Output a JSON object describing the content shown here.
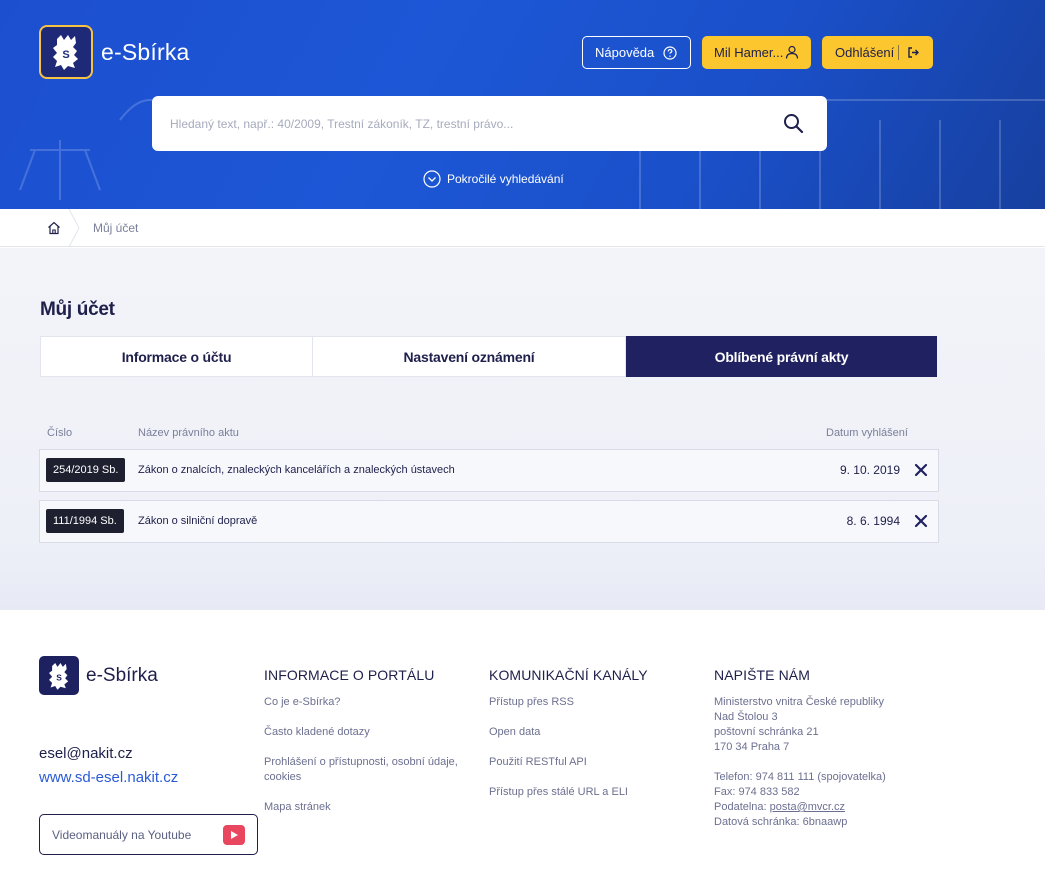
{
  "header": {
    "logo_text": "e-Sbírka",
    "help_label": "Nápověda",
    "user_label": "Mil Hamer...",
    "logout_label": "Odhlášení",
    "search_placeholder": "Hledaný text, např.: 40/2009, Trestní zákoník, TZ, trestní právo...",
    "advanced_search_label": "Pokročilé vyhledávání"
  },
  "breadcrumb": {
    "current": "Můj účet"
  },
  "main": {
    "title": "Můj účet",
    "tabs": [
      {
        "label": "Informace o účtu",
        "active": false
      },
      {
        "label": "Nastavení oznámení",
        "active": false
      },
      {
        "label": "Oblíbené právní akty",
        "active": true
      }
    ],
    "table": {
      "headers": {
        "number": "Číslo",
        "name": "Název právního aktu",
        "date": "Datum vyhlášení"
      },
      "rows": [
        {
          "number": "254/2019 Sb.",
          "name": "Zákon o znalcích, znaleckých kancelářích a znaleckých ústavech",
          "date": "9. 10. 2019"
        },
        {
          "number": "111/1994 Sb.",
          "name": "Zákon o silniční dopravě",
          "date": "8. 6. 1994"
        }
      ]
    }
  },
  "footer": {
    "logo_text": "e-Sbírka",
    "email": "esel@nakit.cz",
    "web": "www.sd-esel.nakit.cz",
    "youtube_label": "Videomanuály na Youtube",
    "col1": {
      "title": "INFORMACE O PORTÁLU",
      "links": [
        "Co je e-Sbírka?",
        "Často kladené dotazy",
        "Prohlášení o přístupnosti, osobní údaje, cookies",
        "Mapa stránek"
      ]
    },
    "col2": {
      "title": "KOMUNIKAČNÍ KANÁLY",
      "links": [
        "Přístup přes RSS",
        "Open data",
        "Použití RESTful API",
        "Přístup přes stálé URL a ELI"
      ]
    },
    "col3": {
      "title": "NAPIŠTE NÁM",
      "address": [
        "Ministerstvo vnitra České republiky",
        "Nad Štolou 3",
        "poštovní schránka 21",
        "170 34 Praha 7"
      ],
      "phone": "Telefon: 974 811 111 (spojovatelka)",
      "fax": "Fax: 974 833 582",
      "filing_label": "Podatelna:",
      "filing_email": "posta@mvcr.cz",
      "databox": "Datová schránka: 6bnaawp"
    }
  },
  "colors": {
    "primary": "#1f2160",
    "accent": "#fcc72e",
    "header_blue": "#1c4fd0",
    "link": "#2a5bd7",
    "youtube": "#e8475f"
  }
}
